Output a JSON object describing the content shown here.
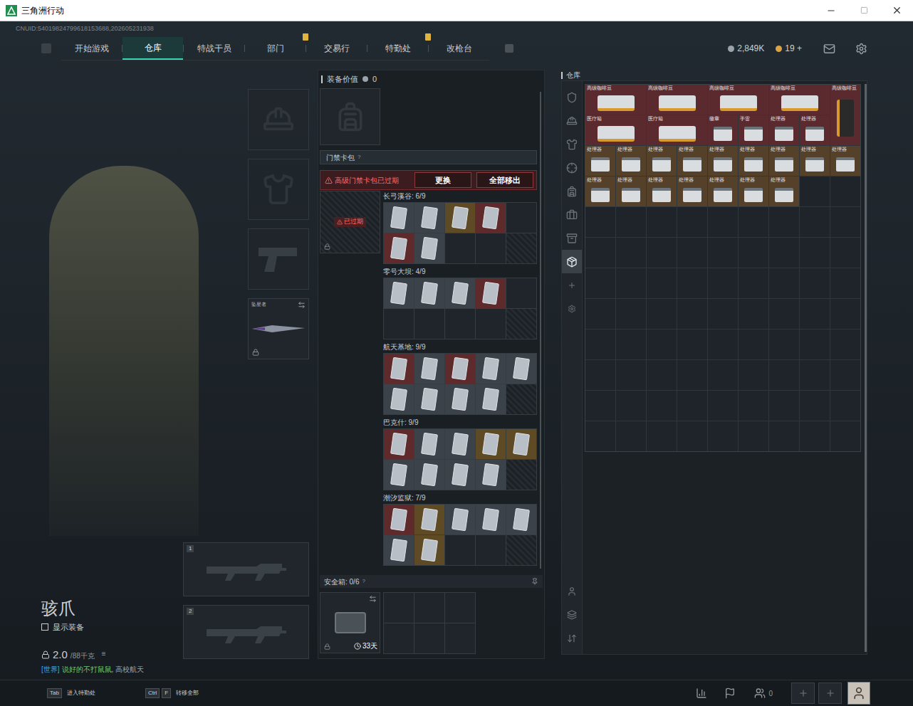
{
  "window": {
    "title": "三角洲行动"
  },
  "cnuid": "CNUID:54019824799618153688,202605231938",
  "nav": {
    "tabs": [
      {
        "label": "开始游戏",
        "selected": false,
        "badge": false
      },
      {
        "label": "仓库",
        "selected": true,
        "badge": false
      },
      {
        "label": "特战干员",
        "selected": false,
        "badge": false
      },
      {
        "label": "部门",
        "selected": false,
        "badge": true
      },
      {
        "label": "交易行",
        "selected": false,
        "badge": false
      },
      {
        "label": "特勤处",
        "selected": false,
        "badge": true
      },
      {
        "label": "改枪台",
        "selected": false,
        "badge": false
      }
    ],
    "currency": [
      {
        "value": "2,849K",
        "color": "#9aa3aa"
      },
      {
        "value": "19 +",
        "color": "#d9a441"
      }
    ]
  },
  "character": {
    "name": "骇爪",
    "show_equipment": {
      "label": "显示装备",
      "checked": false
    },
    "weight": "2.0",
    "capacity": "/88千克",
    "chat": {
      "channel": "[世界]",
      "sender": "说好的不打鼠鼠,",
      "message": "高校航天"
    }
  },
  "equipment": [
    {
      "kind": "helmet",
      "filled": false
    },
    {
      "kind": "armor",
      "filled": false
    },
    {
      "kind": "pistol",
      "filled": false
    }
  ],
  "melee": {
    "label": "坠星者",
    "filled": true,
    "locked": true
  },
  "weapon_slots": [
    {
      "number": "1",
      "filled": false
    },
    {
      "number": "2",
      "filled": false
    }
  ],
  "loadout": {
    "value_label": "装备价值",
    "value": "0",
    "keycard": {
      "title": "门禁卡包",
      "help": "?",
      "warning": "高级门禁卡包已过期",
      "buttons": [
        "更换",
        "全部移出"
      ],
      "status": "已过期",
      "locked": true
    },
    "maps": [
      {
        "label": "长弓溪谷: 6/9",
        "cards": [
          {
            "filled": true,
            "color": "#3b4249"
          },
          {
            "filled": true,
            "color": "#3b4249"
          },
          {
            "filled": true,
            "color": "#5e4a24"
          },
          {
            "filled": true,
            "color": "#5e2a2c"
          },
          {
            "filled": false
          },
          {
            "filled": true,
            "color": "#5e2a2c"
          },
          {
            "filled": true,
            "color": "#3b4249"
          },
          {
            "filled": false
          },
          {
            "filled": false
          }
        ]
      },
      {
        "label": "零号大坝: 4/9",
        "cards": [
          {
            "filled": true,
            "color": "#3b4249"
          },
          {
            "filled": true,
            "color": "#3b4249"
          },
          {
            "filled": true,
            "color": "#3b4249"
          },
          {
            "filled": true,
            "color": "#5e2a2c"
          },
          {
            "filled": false
          },
          {
            "filled": false
          },
          {
            "filled": false
          },
          {
            "filled": false
          },
          {
            "filled": false
          }
        ]
      },
      {
        "label": "航天基地: 9/9",
        "cards": [
          {
            "filled": true,
            "color": "#5e2a2c"
          },
          {
            "filled": true,
            "color": "#3b4249"
          },
          {
            "filled": true,
            "color": "#5e2a2c"
          },
          {
            "filled": true,
            "color": "#3b4249"
          },
          {
            "filled": true,
            "color": "#3b4249"
          },
          {
            "filled": true,
            "color": "#3b4249"
          },
          {
            "filled": true,
            "color": "#3b4249"
          },
          {
            "filled": true,
            "color": "#3b4249"
          },
          {
            "filled": true,
            "color": "#3b4249"
          }
        ]
      },
      {
        "label": "巴克什: 9/9",
        "cards": [
          {
            "filled": true,
            "color": "#5e2a2c"
          },
          {
            "filled": true,
            "color": "#3b4249"
          },
          {
            "filled": true,
            "color": "#3b4249"
          },
          {
            "filled": true,
            "color": "#5e4a24"
          },
          {
            "filled": true,
            "color": "#5e4a24"
          },
          {
            "filled": true,
            "color": "#3b4249"
          },
          {
            "filled": true,
            "color": "#3b4249"
          },
          {
            "filled": true,
            "color": "#3b4249"
          },
          {
            "filled": true,
            "color": "#3b4249"
          }
        ]
      },
      {
        "label": "潮汐监狱: 7/9",
        "cards": [
          {
            "filled": true,
            "color": "#5e2a2c"
          },
          {
            "filled": true,
            "color": "#5e4a24"
          },
          {
            "filled": true,
            "color": "#3b4249"
          },
          {
            "filled": true,
            "color": "#3b4249"
          },
          {
            "filled": true,
            "color": "#3b4249"
          },
          {
            "filled": true,
            "color": "#3b4249"
          },
          {
            "filled": true,
            "color": "#5e4a24"
          },
          {
            "filled": false
          },
          {
            "filled": false
          }
        ]
      }
    ],
    "safe": {
      "label": "安全箱: 0/6",
      "help": "?",
      "days": "33天",
      "locked": true
    }
  },
  "warehouse": {
    "title": "仓库",
    "side_tabs": [
      {
        "selected": false
      },
      {
        "selected": false
      },
      {
        "selected": false
      },
      {
        "selected": false
      },
      {
        "selected": false
      },
      {
        "selected": false
      },
      {
        "selected": false
      },
      {
        "selected": true
      },
      {
        "selected": false
      },
      {
        "selected": false
      }
    ],
    "items": [
      {
        "label": "高级咖啡豆",
        "kind": "wide",
        "color": "#5b2a2e"
      },
      {
        "label": "高级咖啡豆",
        "kind": "wide",
        "color": "#5b2a2e"
      },
      {
        "label": "高级咖啡豆",
        "kind": "wide",
        "color": "#5b2a2e"
      },
      {
        "label": "高级咖啡豆",
        "kind": "wide",
        "color": "#5b2a2e"
      },
      {
        "label": "高级咖啡豆",
        "kind": "tall",
        "color": "#5b2a2e"
      },
      {
        "label": "医疗箱",
        "kind": "wide",
        "color": "#5b2a2e"
      },
      {
        "label": "医疗箱",
        "kind": "wide",
        "color": "#5b2a2e"
      },
      {
        "label": "徽章",
        "kind": "small",
        "color": "#5b2a2e"
      },
      {
        "label": "手雷",
        "kind": "small",
        "color": "#5b2a2e"
      },
      {
        "label": "处理器",
        "kind": "small",
        "color": "#5b2a2e"
      },
      {
        "label": "处理器",
        "kind": "small",
        "color": "#5b2a2e"
      },
      {
        "label": "处理器",
        "kind": "small",
        "color": "#55402a"
      },
      {
        "label": "处理器",
        "kind": "small",
        "color": "#55402a"
      },
      {
        "label": "处理器",
        "kind": "small",
        "color": "#55402a"
      },
      {
        "label": "处理器",
        "kind": "small",
        "color": "#55402a"
      },
      {
        "label": "处理器",
        "kind": "small",
        "color": "#55402a"
      },
      {
        "label": "处理器",
        "kind": "small",
        "color": "#55402a"
      },
      {
        "label": "处理器",
        "kind": "small",
        "color": "#55402a"
      },
      {
        "label": "处理器",
        "kind": "small",
        "color": "#55402a"
      },
      {
        "label": "处理器",
        "kind": "small",
        "color": "#55402a"
      },
      {
        "label": "处理器",
        "kind": "small",
        "color": "#55402a"
      },
      {
        "label": "处理器",
        "kind": "small",
        "color": "#55402a"
      },
      {
        "label": "处理器",
        "kind": "small",
        "color": "#55402a"
      },
      {
        "label": "处理器",
        "kind": "small",
        "color": "#55402a"
      },
      {
        "label": "处理器",
        "kind": "small",
        "color": "#55402a"
      },
      {
        "label": "处理器",
        "kind": "small",
        "color": "#55402a"
      },
      {
        "label": "处理器",
        "kind": "small",
        "color": "#55402a"
      }
    ]
  },
  "footer": {
    "hints": [
      {
        "keys": [
          "Tab"
        ],
        "label": "进入特勤处"
      },
      {
        "keys": [
          "Ctrl",
          "F"
        ],
        "label": "转移全部"
      }
    ],
    "friends": "0"
  }
}
